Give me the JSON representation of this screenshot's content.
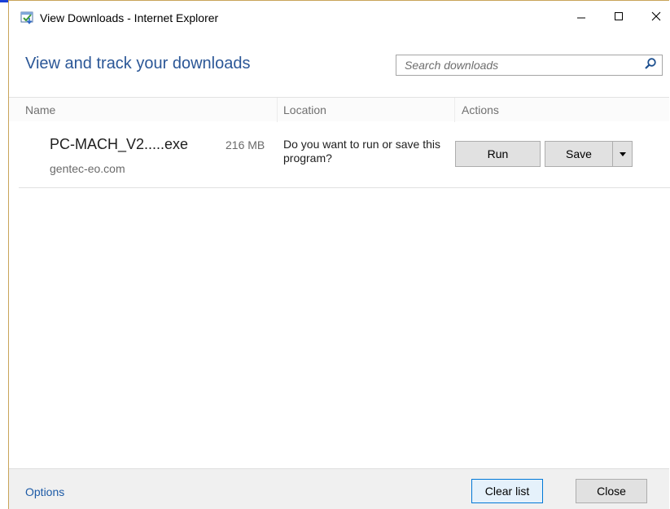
{
  "window": {
    "title": "View Downloads - Internet Explorer",
    "controls": {
      "minimize": "minimize-icon",
      "maximize": "maximize-icon",
      "close": "close-icon"
    }
  },
  "header": {
    "heading": "View and track your downloads",
    "search": {
      "placeholder": "Search downloads",
      "value": ""
    }
  },
  "columns": {
    "name": "Name",
    "location": "Location",
    "actions": "Actions"
  },
  "downloads": [
    {
      "file_name": "PC-MACH_V2.....exe",
      "size": "216 MB",
      "source": "gentec-eo.com",
      "prompt": "Do you want to run or save this program?",
      "run_label": "Run",
      "save_label": "Save"
    }
  ],
  "footer": {
    "options_label": "Options",
    "clear_label": "Clear list",
    "close_label": "Close"
  },
  "colors": {
    "heading": "#2b5797",
    "link": "#1c5aa6",
    "focus_border": "#0078d7",
    "button_face": "#e1e1e1",
    "footer_bg": "#f0f0f0"
  }
}
